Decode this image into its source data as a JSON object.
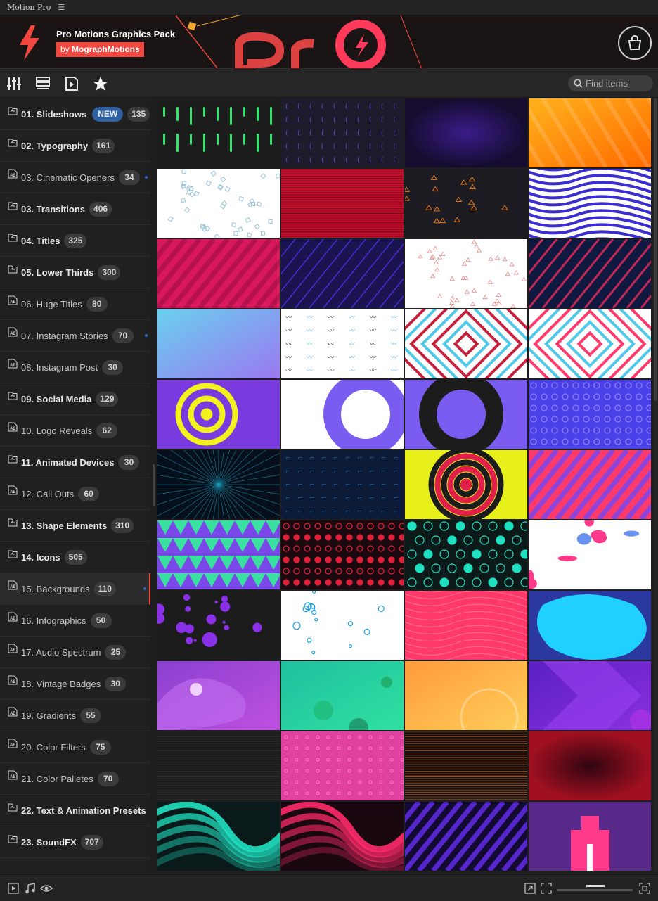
{
  "app": {
    "title": "Motion Pro",
    "menu_icon": "hamburger-icon"
  },
  "banner": {
    "title": "Pro Motions Graphics Pack",
    "by_prefix": "by ",
    "by_name": "MographMotions",
    "logo_icon": "lightning-bolt-icon",
    "shop_icon": "shopping-bag-icon",
    "accent": "#f0483e"
  },
  "toolbar": {
    "icons": [
      "sliders-icon",
      "list-view-icon",
      "media-player-icon",
      "favorites-star-icon"
    ],
    "search": {
      "placeholder": "Find items",
      "icon": "search-icon"
    }
  },
  "sidebar": {
    "items": [
      {
        "label": "01. Slideshows",
        "count": "135",
        "badge": "NEW",
        "type": "folder",
        "weight": "bold"
      },
      {
        "label": "02. Typography",
        "count": "161",
        "type": "folder",
        "weight": "bold"
      },
      {
        "label": "03. Cinematic Openers",
        "count": "34",
        "type": "ae",
        "weight": "light",
        "dot": true
      },
      {
        "label": "03. Transitions",
        "count": "406",
        "type": "folder",
        "weight": "bold"
      },
      {
        "label": "04. Titles",
        "count": "325",
        "type": "folder",
        "weight": "bold"
      },
      {
        "label": "05. Lower Thirds",
        "count": "300",
        "type": "folder",
        "weight": "bold"
      },
      {
        "label": "06. Huge Titles",
        "count": "80",
        "type": "ae",
        "weight": "light"
      },
      {
        "label": "07. Instagram Stories",
        "count": "70",
        "type": "ae",
        "weight": "light",
        "dot": true
      },
      {
        "label": "08. Instagram Post",
        "count": "30",
        "type": "ae",
        "weight": "light"
      },
      {
        "label": "09. Social Media",
        "count": "129",
        "type": "folder",
        "weight": "bold"
      },
      {
        "label": "10. Logo Reveals",
        "count": "62",
        "type": "ae",
        "weight": "light"
      },
      {
        "label": "11. Animated Devices",
        "count": "30",
        "type": "folder",
        "weight": "bold"
      },
      {
        "label": "12. Call Outs",
        "count": "60",
        "type": "ae",
        "weight": "light"
      },
      {
        "label": "13. Shape Elements",
        "count": "310",
        "type": "folder",
        "weight": "bold"
      },
      {
        "label": "14. Icons",
        "count": "505",
        "type": "folder",
        "weight": "bold"
      },
      {
        "label": "15. Backgrounds",
        "count": "110",
        "type": "ae",
        "weight": "light",
        "dot": true,
        "active": true
      },
      {
        "label": "16. Infographics",
        "count": "50",
        "type": "ae",
        "weight": "light"
      },
      {
        "label": "17. Audio Spectrum",
        "count": "25",
        "type": "ae",
        "weight": "light"
      },
      {
        "label": "18. Vintage Badges",
        "count": "30",
        "type": "ae",
        "weight": "light"
      },
      {
        "label": "19. Gradients",
        "count": "55",
        "type": "ae",
        "weight": "light"
      },
      {
        "label": "20. Color Filters",
        "count": "75",
        "type": "ae",
        "weight": "light"
      },
      {
        "label": "21. Color Palletes",
        "count": "70",
        "type": "ae",
        "weight": "light"
      },
      {
        "label": "22. Text & Animation Presets",
        "count": "",
        "type": "folder",
        "weight": "bold"
      },
      {
        "label": "23. SoundFX",
        "count": "707",
        "type": "folder",
        "weight": "bold"
      }
    ]
  },
  "thumbnails": [
    {
      "style": "neon-bars",
      "colors": [
        "#1c1c1c",
        "#2ee66b"
      ]
    },
    {
      "style": "crescents",
      "colors": [
        "#1c1c2c",
        "#5d4fd6"
      ]
    },
    {
      "style": "radial",
      "colors": [
        "#3a1c8a",
        "#150c2e"
      ]
    },
    {
      "style": "stripes",
      "colors": [
        "#ffb21c",
        "#ff6a00"
      ]
    },
    {
      "style": "squares-outline",
      "colors": [
        "#ffffff",
        "#9bc4d6"
      ]
    },
    {
      "style": "streak",
      "colors": [
        "#c8102e",
        "#5a0a14"
      ]
    },
    {
      "style": "triangles",
      "colors": [
        "#1c1c22",
        "#e07a1f"
      ]
    },
    {
      "style": "waves",
      "colors": [
        "#ffffff",
        "#3a2ed0"
      ]
    },
    {
      "style": "diagonal",
      "colors": [
        "#d9175c",
        "#a8104a"
      ]
    },
    {
      "style": "diagonal-lines",
      "colors": [
        "#1a1450",
        "#5b34ff"
      ]
    },
    {
      "style": "triangles-outline",
      "colors": [
        "#ffffff",
        "#e58a8a"
      ]
    },
    {
      "style": "slashes",
      "colors": [
        "#101a40",
        "#ff2e5e"
      ]
    },
    {
      "style": "gradient",
      "colors": [
        "#6ad0f0",
        "#9a78f0"
      ]
    },
    {
      "style": "squiggles",
      "colors": [
        "#ffffff",
        "#2a2a2a"
      ]
    },
    {
      "style": "concentric-squares",
      "colors": [
        "#ffffff",
        "#c8203a"
      ]
    },
    {
      "style": "diamonds",
      "colors": [
        "#ffffff",
        "#ff3a6a"
      ]
    },
    {
      "style": "rings",
      "colors": [
        "#7a3ae0",
        "#f2f21c"
      ]
    },
    {
      "style": "gear",
      "colors": [
        "#ffffff",
        "#7a5cf0"
      ]
    },
    {
      "style": "gear-dark",
      "colors": [
        "#7a5cf0",
        "#1c1c1c"
      ]
    },
    {
      "style": "dots-circles",
      "colors": [
        "#4a40e8",
        "#8a80ff"
      ]
    },
    {
      "style": "burst",
      "colors": [
        "#06101c",
        "#1fa0c0"
      ]
    },
    {
      "style": "tiny-marks",
      "colors": [
        "#0c1c38",
        "#2060a0"
      ]
    },
    {
      "style": "target",
      "colors": [
        "#e8f01c",
        "#e0204a"
      ]
    },
    {
      "style": "chevrons",
      "colors": [
        "#ff3a6a",
        "#6a48ff"
      ]
    },
    {
      "style": "tri-pattern",
      "colors": [
        "#7a48e8",
        "#3ae0a0"
      ]
    },
    {
      "style": "dot-grid",
      "colors": [
        "#1a0a10",
        "#e0203a"
      ]
    },
    {
      "style": "hexes",
      "colors": [
        "#0c1a1a",
        "#1fe0c0"
      ]
    },
    {
      "style": "blobs",
      "colors": [
        "#ffffff",
        "#ff3a8a"
      ]
    },
    {
      "style": "bubbles",
      "colors": [
        "#1c1c1c",
        "#8a30e8"
      ]
    },
    {
      "style": "circles-light",
      "colors": [
        "#ffffff",
        "#1aa0e0"
      ]
    },
    {
      "style": "wavy-lines",
      "colors": [
        "#ff3a6a",
        "#ff6a8a"
      ]
    },
    {
      "style": "liquid",
      "colors": [
        "#2a38a0",
        "#20d0ff"
      ]
    },
    {
      "style": "purple-blob",
      "colors": [
        "#8a40d0",
        "#c050e0"
      ]
    },
    {
      "style": "mint",
      "colors": [
        "#20c0a0",
        "#30e0a0"
      ]
    },
    {
      "style": "sunset",
      "colors": [
        "#ff9a3a",
        "#ffcf5a"
      ]
    },
    {
      "style": "arrow",
      "colors": [
        "#5a20c0",
        "#8a30e0"
      ]
    },
    {
      "style": "dark-streaks",
      "colors": [
        "#1c1c1c",
        "#333333"
      ]
    },
    {
      "style": "pink-dots",
      "colors": [
        "#e040a0",
        "#ff70c0"
      ]
    },
    {
      "style": "scanlines",
      "colors": [
        "#141010",
        "#c0602a"
      ]
    },
    {
      "style": "dark-red",
      "colors": [
        "#300510",
        "#a01020"
      ]
    },
    {
      "style": "teal-swirl",
      "colors": [
        "#0a1a1a",
        "#20e0c0"
      ]
    },
    {
      "style": "pink-swirl",
      "colors": [
        "#1a0810",
        "#ff2a6a"
      ]
    },
    {
      "style": "violet-beams",
      "colors": [
        "#120a30",
        "#6a30ff"
      ]
    },
    {
      "style": "pixel-pink",
      "colors": [
        "#5a2a8a",
        "#ff3a8a"
      ]
    }
  ],
  "bottombar": {
    "left_icons": [
      "play-preview-icon",
      "music-note-icon",
      "eye-icon"
    ],
    "right_icons": [
      "expand-icon",
      "fit-screen-icon",
      "fullscreen-icon"
    ],
    "zoom_level": 0.5
  }
}
